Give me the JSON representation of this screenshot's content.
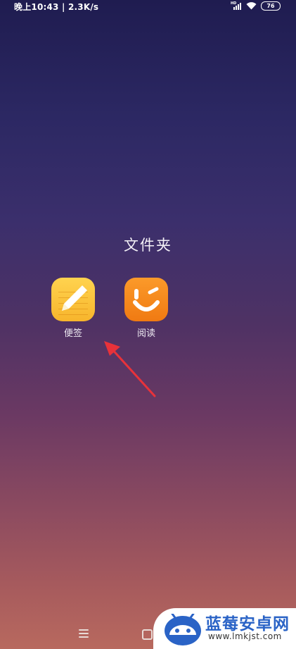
{
  "status_bar": {
    "time": "晚上10:43",
    "separator": "|",
    "network_speed": "2.3K/s",
    "signal_label": "HD",
    "battery": "76",
    "icons": [
      "signal-icon",
      "wifi-icon",
      "battery-icon"
    ]
  },
  "folder": {
    "title": "文件夹",
    "apps": [
      {
        "label": "便签",
        "icon": "notes-pencil-icon"
      },
      {
        "label": "阅读",
        "icon": "reading-smile-icon"
      }
    ]
  },
  "annotation": {
    "type": "red-arrow",
    "points_to": "便签",
    "color": "#e8323a"
  },
  "nav_bar": {
    "icons": [
      "menu-icon",
      "home-icon"
    ]
  },
  "watermark": {
    "title": "蓝莓安卓网",
    "url": "www.lmkjst.com",
    "brand_color": "#2a63c6"
  }
}
